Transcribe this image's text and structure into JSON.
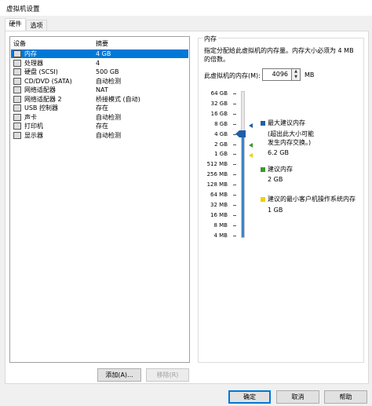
{
  "window": {
    "title": "虚拟机设置"
  },
  "tabs": [
    {
      "label": "硬件",
      "active": true
    },
    {
      "label": "选项",
      "active": false
    }
  ],
  "device_list": {
    "col_device": "设备",
    "col_summary": "摘要",
    "items": [
      {
        "name": "内存",
        "summary": "4 GB",
        "icon": "memory-icon",
        "selected": true
      },
      {
        "name": "处理器",
        "summary": "4",
        "icon": "processor-icon"
      },
      {
        "name": "硬盘 (SCSI)",
        "summary": "500 GB",
        "icon": "harddisk-icon"
      },
      {
        "name": "CD/DVD (SATA)",
        "summary": "自动检测",
        "icon": "cdrom-icon"
      },
      {
        "name": "网络适配器",
        "summary": "NAT",
        "icon": "network-icon"
      },
      {
        "name": "网络适配器 2",
        "summary": "桥接模式 (自动)",
        "icon": "network-icon"
      },
      {
        "name": "USB 控制器",
        "summary": "存在",
        "icon": "usb-icon"
      },
      {
        "name": "声卡",
        "summary": "自动检测",
        "icon": "sound-icon"
      },
      {
        "name": "打印机",
        "summary": "存在",
        "icon": "printer-icon"
      },
      {
        "name": "显示器",
        "summary": "自动检测",
        "icon": "display-icon"
      }
    ]
  },
  "device_buttons": {
    "add": "添加(A)...",
    "remove": "移除(R)"
  },
  "memory": {
    "group_title": "内存",
    "description": "指定分配给此虚拟机的内存量。内存大小必须为 4 MB 的倍数。",
    "field_label": "此虚拟机的内存(M):",
    "value": "4096",
    "unit": "MB",
    "scale_labels": [
      "64 GB",
      "32 GB",
      "16 GB",
      "8 GB",
      "4 GB",
      "2 GB",
      "1 GB",
      "512 MB",
      "256 MB",
      "128 MB",
      "64 MB",
      "32 MB",
      "16 MB",
      "8 MB",
      "4 MB"
    ],
    "current_index": 4,
    "legend": {
      "max_title": "最大建议内存",
      "max_note_1": "(超出此大小可能",
      "max_note_2": "发生内存交换。)",
      "max_value": "6.2 GB",
      "rec_title": "建议内存",
      "rec_value": "2 GB",
      "min_title": "建议的最小客户机操作系统内存",
      "min_value": "1 GB"
    },
    "colors": {
      "max": "#1f5fa8",
      "rec": "#3a9a2a",
      "min": "#f0d000",
      "fill": "#3b86cf"
    }
  },
  "footer": {
    "ok": "确定",
    "cancel": "取消",
    "help": "帮助"
  }
}
